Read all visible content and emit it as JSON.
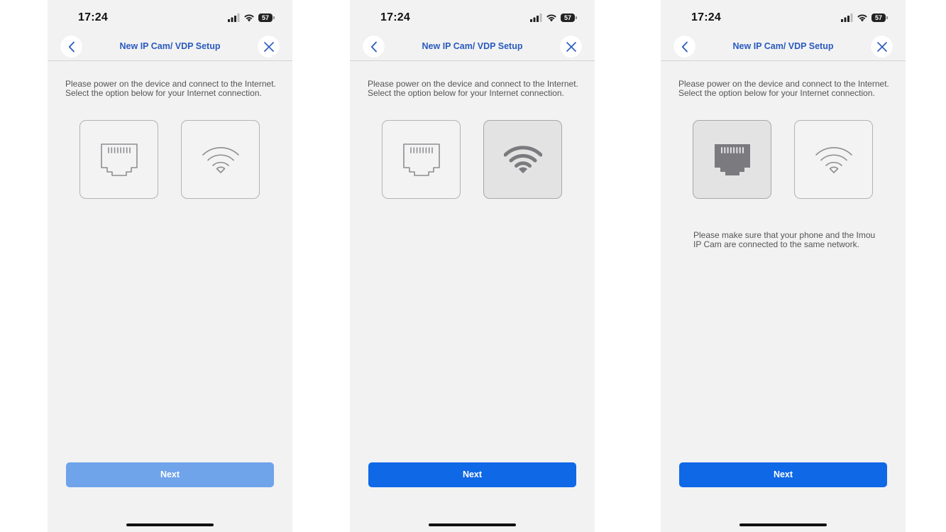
{
  "colors": {
    "accent": "#0f68e6",
    "accent_disabled": "#6fa3ea",
    "title_blue": "#2a5bbd",
    "background": "#f2f2f3",
    "selected_tile": "#e3e3e4"
  },
  "screens": [
    {
      "status_time": "17:24",
      "battery": "57",
      "title": "New IP Cam/ VDP Setup",
      "instruction_line1": "Please power on the device and connect to the Internet.",
      "instruction_line2": "Select the option below for your Internet connection.",
      "selected_option": "none",
      "note_line1": "",
      "note_line2": "",
      "next_label": "Next",
      "next_enabled": false
    },
    {
      "status_time": "17:24",
      "battery": "57",
      "title": "New IP Cam/ VDP Setup",
      "instruction_line1": "Please power on the device and connect to the Internet.",
      "instruction_line2": "Select the option below for your Internet connection.",
      "selected_option": "wifi",
      "note_line1": "",
      "note_line2": "",
      "next_label": "Next",
      "next_enabled": true
    },
    {
      "status_time": "17:24",
      "battery": "57",
      "title": "New IP Cam/ VDP Setup",
      "instruction_line1": "Please power on the device and connect to the Internet.",
      "instruction_line2": "Select the option below for your Internet connection.",
      "selected_option": "ethernet",
      "note_line1": "Please make sure that your phone and the Imou",
      "note_line2": "IP Cam are connected to the same network.",
      "next_label": "Next",
      "next_enabled": true
    }
  ],
  "icons": {
    "back": "chevron-left-icon",
    "close": "close-icon",
    "ethernet": "ethernet-port-icon",
    "wifi": "wifi-icon",
    "signal": "cellular-signal-icon",
    "status_wifi": "status-wifi-icon",
    "battery": "battery-icon"
  }
}
